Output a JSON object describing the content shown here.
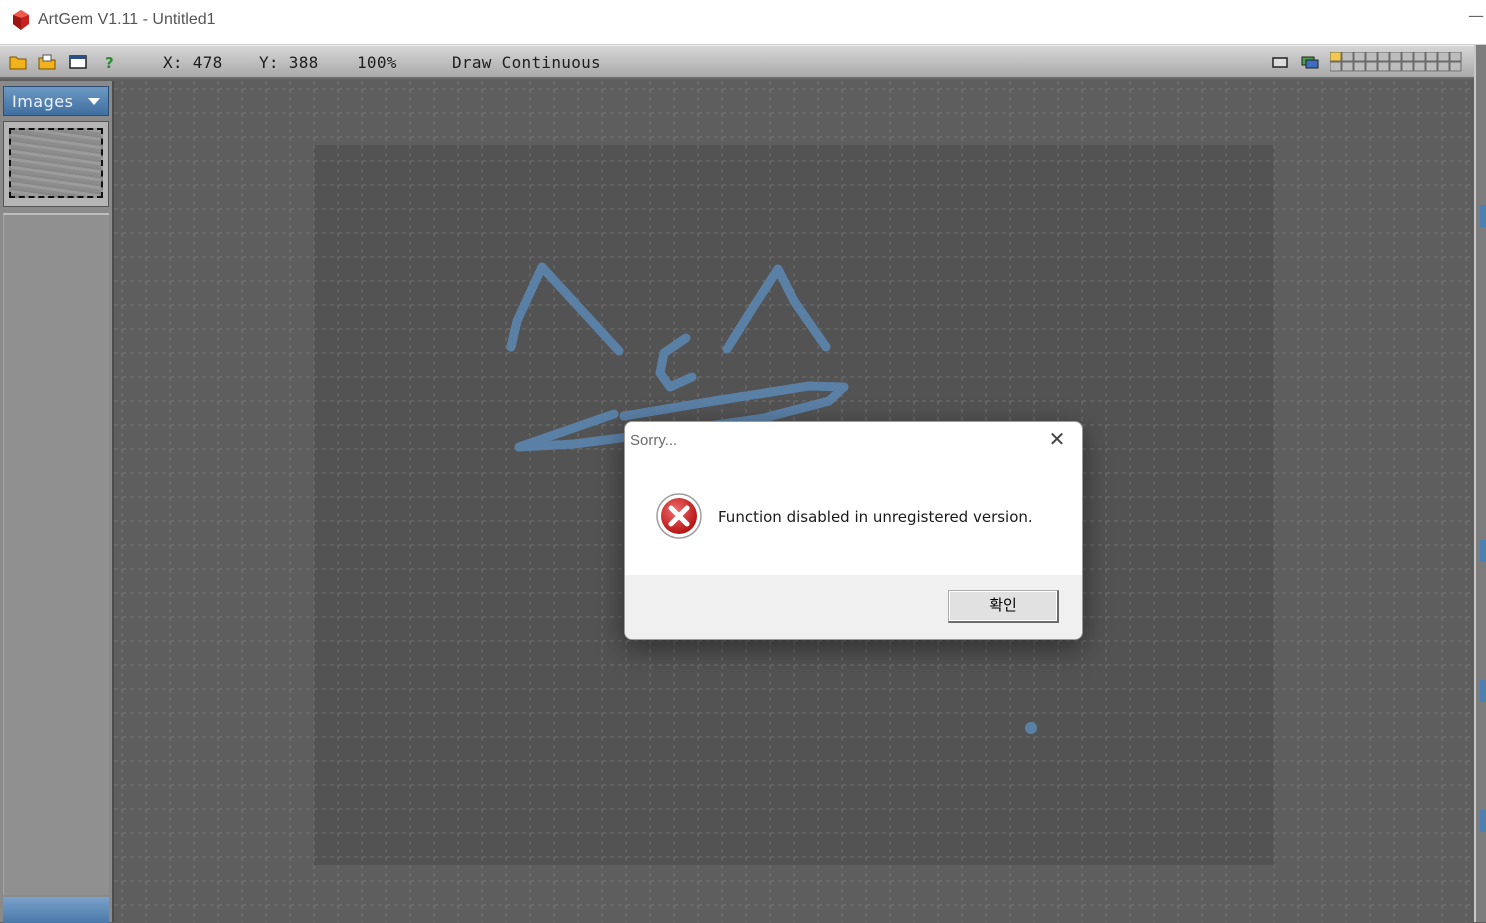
{
  "window": {
    "title": "ArtGem V1.11 - Untitled1",
    "minimize_glyph": "—"
  },
  "toolbar": {
    "icons": [
      "open-folder-icon",
      "open-file-icon",
      "window-icon",
      "help-icon"
    ],
    "x_label": "X: 478",
    "y_label": "Y: 388",
    "zoom": "100%",
    "mode": "Draw Continuous",
    "right_icons": [
      "frame-icon",
      "layers-icon",
      "grid-swatch-icon"
    ]
  },
  "left_panel": {
    "header_label": "Images"
  },
  "dialog": {
    "title": "Sorry...",
    "close_glyph": "✕",
    "message": "Function disabled in unregistered version.",
    "ok_label": "확인",
    "icon": "error-icon"
  },
  "colors": {
    "stroke": "#5b80a6",
    "page": "#535353",
    "workspace": "#5e5e5e",
    "panel_header": "#4f7fae"
  }
}
